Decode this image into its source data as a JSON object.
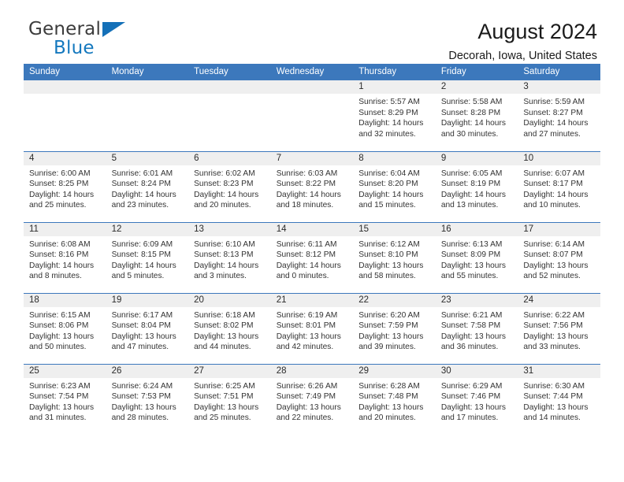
{
  "logo": {
    "word_top": "General",
    "word_bottom": "Blue",
    "triangle": "triangle-icon"
  },
  "header": {
    "title": "August 2024",
    "subtitle": "Decorah, Iowa, United States"
  },
  "colors": {
    "header_blue": "#3c78bc",
    "logo_blue": "#1478be",
    "band_gray": "#efefef"
  },
  "weekday_headers": [
    "Sunday",
    "Monday",
    "Tuesday",
    "Wednesday",
    "Thursday",
    "Friday",
    "Saturday"
  ],
  "weeks": [
    [
      {
        "day": "",
        "lines": []
      },
      {
        "day": "",
        "lines": []
      },
      {
        "day": "",
        "lines": []
      },
      {
        "day": "",
        "lines": []
      },
      {
        "day": "1",
        "lines": [
          "Sunrise: 5:57 AM",
          "Sunset: 8:29 PM",
          "Daylight: 14 hours",
          "and 32 minutes."
        ]
      },
      {
        "day": "2",
        "lines": [
          "Sunrise: 5:58 AM",
          "Sunset: 8:28 PM",
          "Daylight: 14 hours",
          "and 30 minutes."
        ]
      },
      {
        "day": "3",
        "lines": [
          "Sunrise: 5:59 AM",
          "Sunset: 8:27 PM",
          "Daylight: 14 hours",
          "and 27 minutes."
        ]
      }
    ],
    [
      {
        "day": "4",
        "lines": [
          "Sunrise: 6:00 AM",
          "Sunset: 8:25 PM",
          "Daylight: 14 hours",
          "and 25 minutes."
        ]
      },
      {
        "day": "5",
        "lines": [
          "Sunrise: 6:01 AM",
          "Sunset: 8:24 PM",
          "Daylight: 14 hours",
          "and 23 minutes."
        ]
      },
      {
        "day": "6",
        "lines": [
          "Sunrise: 6:02 AM",
          "Sunset: 8:23 PM",
          "Daylight: 14 hours",
          "and 20 minutes."
        ]
      },
      {
        "day": "7",
        "lines": [
          "Sunrise: 6:03 AM",
          "Sunset: 8:22 PM",
          "Daylight: 14 hours",
          "and 18 minutes."
        ]
      },
      {
        "day": "8",
        "lines": [
          "Sunrise: 6:04 AM",
          "Sunset: 8:20 PM",
          "Daylight: 14 hours",
          "and 15 minutes."
        ]
      },
      {
        "day": "9",
        "lines": [
          "Sunrise: 6:05 AM",
          "Sunset: 8:19 PM",
          "Daylight: 14 hours",
          "and 13 minutes."
        ]
      },
      {
        "day": "10",
        "lines": [
          "Sunrise: 6:07 AM",
          "Sunset: 8:17 PM",
          "Daylight: 14 hours",
          "and 10 minutes."
        ]
      }
    ],
    [
      {
        "day": "11",
        "lines": [
          "Sunrise: 6:08 AM",
          "Sunset: 8:16 PM",
          "Daylight: 14 hours",
          "and 8 minutes."
        ]
      },
      {
        "day": "12",
        "lines": [
          "Sunrise: 6:09 AM",
          "Sunset: 8:15 PM",
          "Daylight: 14 hours",
          "and 5 minutes."
        ]
      },
      {
        "day": "13",
        "lines": [
          "Sunrise: 6:10 AM",
          "Sunset: 8:13 PM",
          "Daylight: 14 hours",
          "and 3 minutes."
        ]
      },
      {
        "day": "14",
        "lines": [
          "Sunrise: 6:11 AM",
          "Sunset: 8:12 PM",
          "Daylight: 14 hours",
          "and 0 minutes."
        ]
      },
      {
        "day": "15",
        "lines": [
          "Sunrise: 6:12 AM",
          "Sunset: 8:10 PM",
          "Daylight: 13 hours",
          "and 58 minutes."
        ]
      },
      {
        "day": "16",
        "lines": [
          "Sunrise: 6:13 AM",
          "Sunset: 8:09 PM",
          "Daylight: 13 hours",
          "and 55 minutes."
        ]
      },
      {
        "day": "17",
        "lines": [
          "Sunrise: 6:14 AM",
          "Sunset: 8:07 PM",
          "Daylight: 13 hours",
          "and 52 minutes."
        ]
      }
    ],
    [
      {
        "day": "18",
        "lines": [
          "Sunrise: 6:15 AM",
          "Sunset: 8:06 PM",
          "Daylight: 13 hours",
          "and 50 minutes."
        ]
      },
      {
        "day": "19",
        "lines": [
          "Sunrise: 6:17 AM",
          "Sunset: 8:04 PM",
          "Daylight: 13 hours",
          "and 47 minutes."
        ]
      },
      {
        "day": "20",
        "lines": [
          "Sunrise: 6:18 AM",
          "Sunset: 8:02 PM",
          "Daylight: 13 hours",
          "and 44 minutes."
        ]
      },
      {
        "day": "21",
        "lines": [
          "Sunrise: 6:19 AM",
          "Sunset: 8:01 PM",
          "Daylight: 13 hours",
          "and 42 minutes."
        ]
      },
      {
        "day": "22",
        "lines": [
          "Sunrise: 6:20 AM",
          "Sunset: 7:59 PM",
          "Daylight: 13 hours",
          "and 39 minutes."
        ]
      },
      {
        "day": "23",
        "lines": [
          "Sunrise: 6:21 AM",
          "Sunset: 7:58 PM",
          "Daylight: 13 hours",
          "and 36 minutes."
        ]
      },
      {
        "day": "24",
        "lines": [
          "Sunrise: 6:22 AM",
          "Sunset: 7:56 PM",
          "Daylight: 13 hours",
          "and 33 minutes."
        ]
      }
    ],
    [
      {
        "day": "25",
        "lines": [
          "Sunrise: 6:23 AM",
          "Sunset: 7:54 PM",
          "Daylight: 13 hours",
          "and 31 minutes."
        ]
      },
      {
        "day": "26",
        "lines": [
          "Sunrise: 6:24 AM",
          "Sunset: 7:53 PM",
          "Daylight: 13 hours",
          "and 28 minutes."
        ]
      },
      {
        "day": "27",
        "lines": [
          "Sunrise: 6:25 AM",
          "Sunset: 7:51 PM",
          "Daylight: 13 hours",
          "and 25 minutes."
        ]
      },
      {
        "day": "28",
        "lines": [
          "Sunrise: 6:26 AM",
          "Sunset: 7:49 PM",
          "Daylight: 13 hours",
          "and 22 minutes."
        ]
      },
      {
        "day": "29",
        "lines": [
          "Sunrise: 6:28 AM",
          "Sunset: 7:48 PM",
          "Daylight: 13 hours",
          "and 20 minutes."
        ]
      },
      {
        "day": "30",
        "lines": [
          "Sunrise: 6:29 AM",
          "Sunset: 7:46 PM",
          "Daylight: 13 hours",
          "and 17 minutes."
        ]
      },
      {
        "day": "31",
        "lines": [
          "Sunrise: 6:30 AM",
          "Sunset: 7:44 PM",
          "Daylight: 13 hours",
          "and 14 minutes."
        ]
      }
    ]
  ]
}
